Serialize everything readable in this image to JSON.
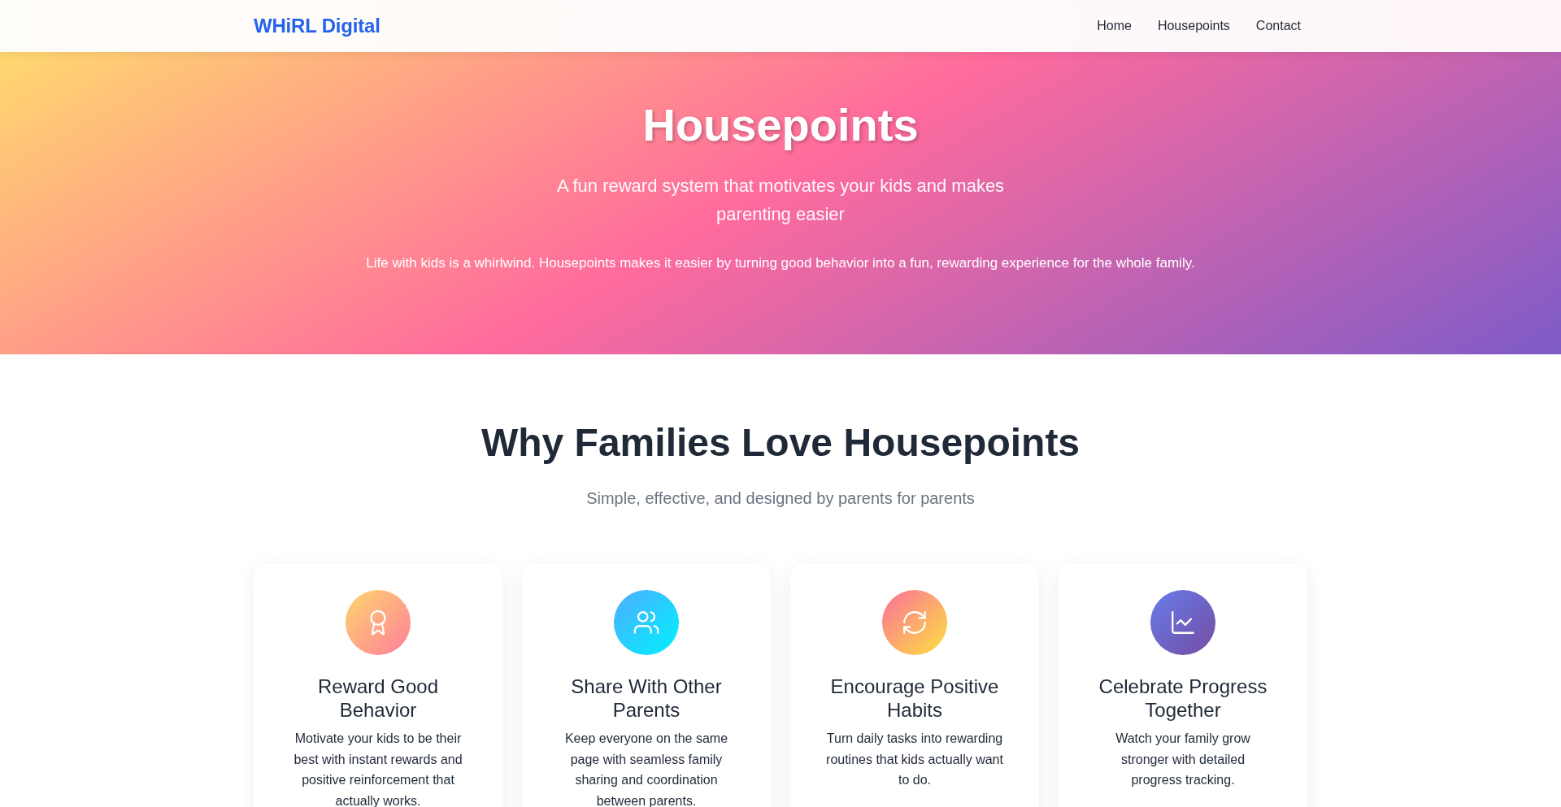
{
  "navbar": {
    "logo": "WHiRL Digital",
    "links": [
      "Home",
      "Housepoints",
      "Contact"
    ]
  },
  "hero": {
    "title": "Housepoints",
    "subtitle": "A fun reward system that motivates your kids and makes parenting easier",
    "description": "Life with kids is a whirlwind. Housepoints makes it easier by turning good behavior into a fun, rewarding experience for the whole family."
  },
  "features": {
    "title": "Why Families Love Housepoints",
    "subtitle": "Simple, effective, and designed by parents for parents",
    "cards": [
      {
        "kind": "award",
        "title": "Reward Good Behavior",
        "text": "Motivate your kids to be their best with instant rewards and positive reinforcement that actually works."
      },
      {
        "kind": "users",
        "title": "Share With Other Parents",
        "text": "Keep everyone on the same page with seamless family sharing and coordination between parents."
      },
      {
        "kind": "refresh",
        "title": "Encourage Positive Habits",
        "text": "Turn daily tasks into rewarding routines that kids actually want to do."
      },
      {
        "kind": "chart",
        "title": "Celebrate Progress Together",
        "text": "Watch your family grow stronger with detailed progress tracking."
      }
    ]
  }
}
